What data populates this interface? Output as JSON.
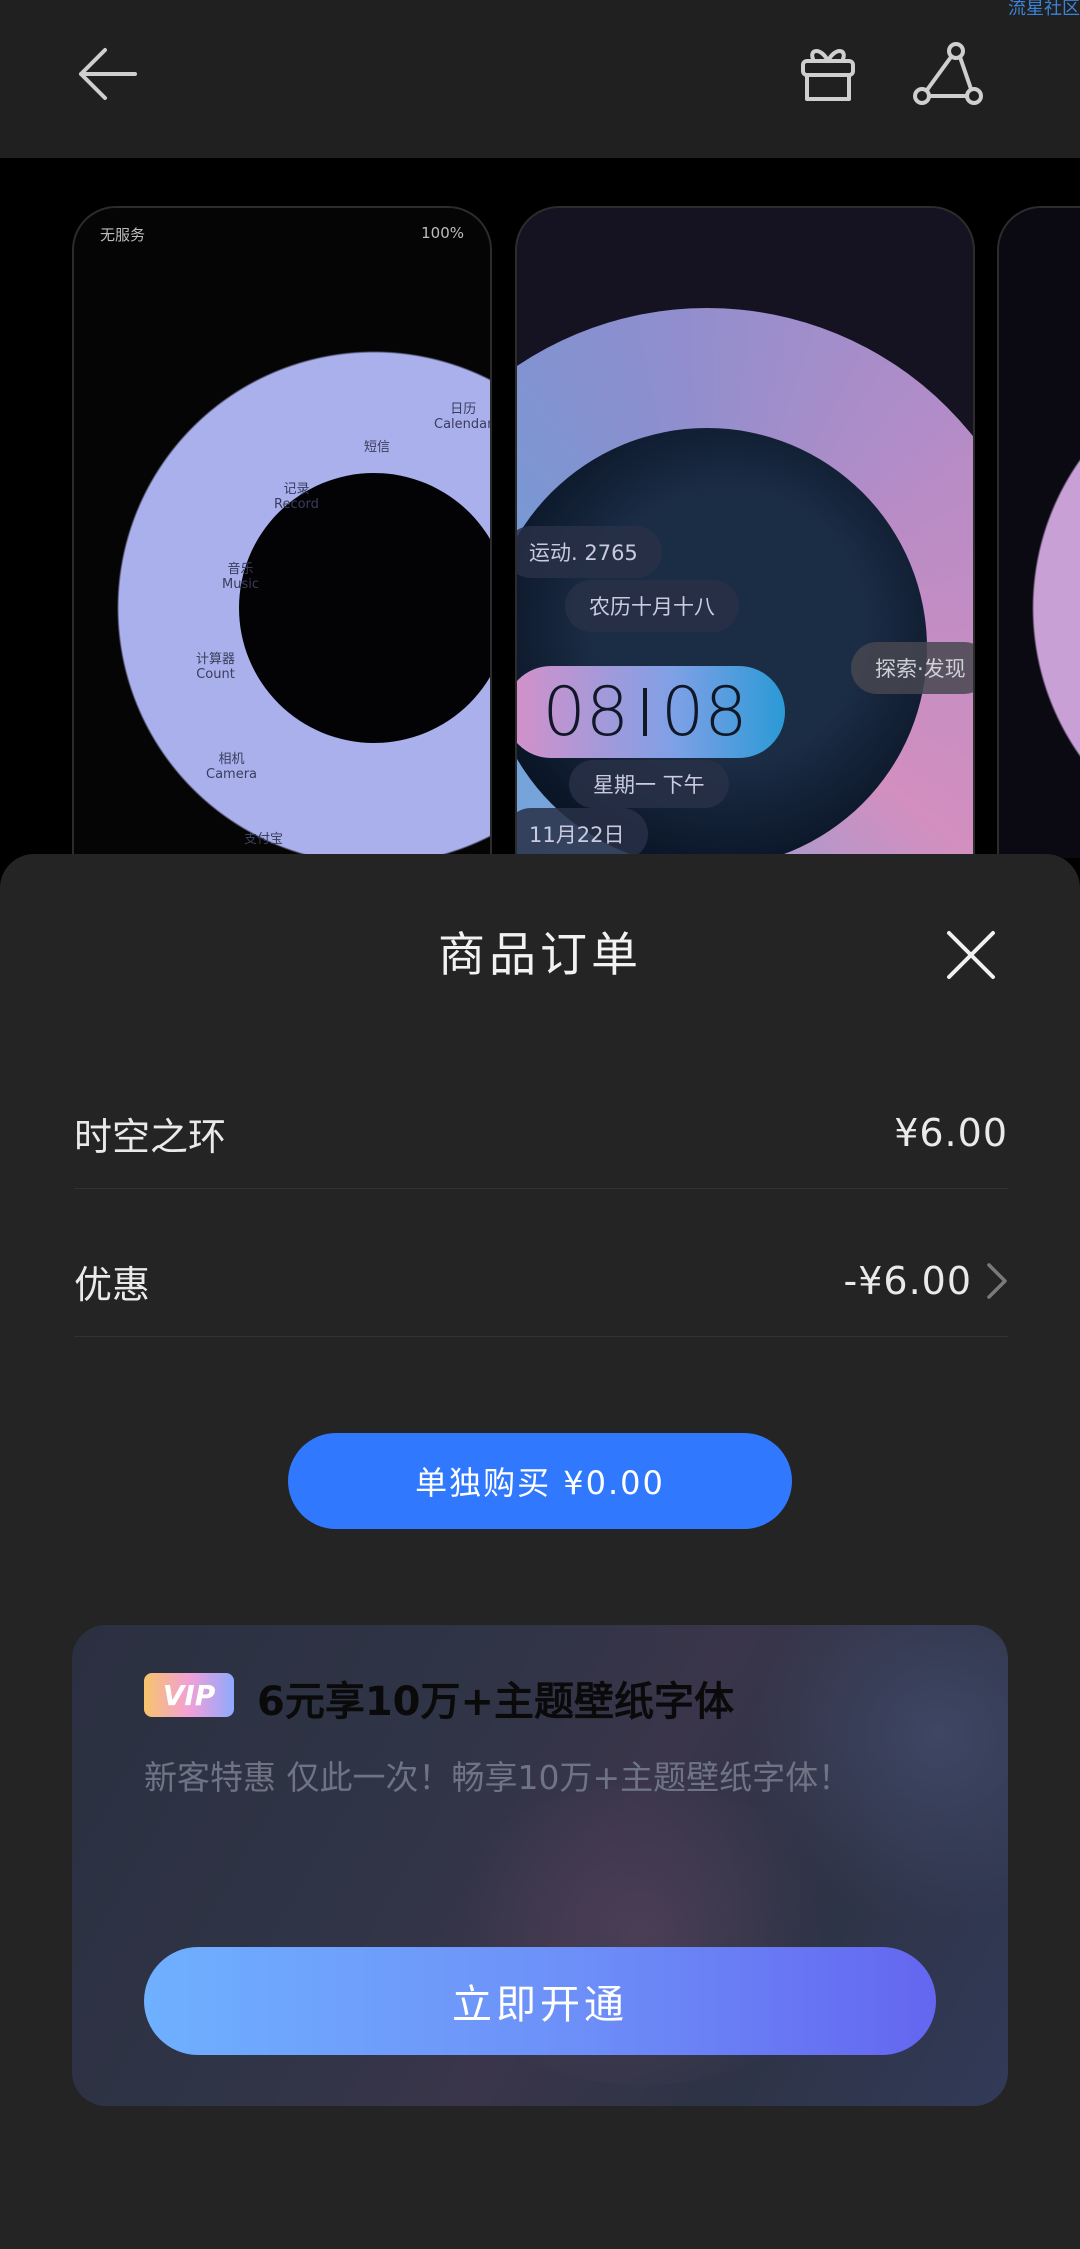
{
  "topbar": {
    "back_icon": "arrow-left-icon",
    "gift_icon": "gift-icon",
    "share_icon": "share-icon",
    "corner_tag": "流星社区"
  },
  "preview": {
    "phone1": {
      "status_left": "无服务",
      "status_right": "100%",
      "apps": [
        {
          "label": "日历",
          "sub": "Calendar"
        },
        {
          "label": "短信",
          "sub": "短信"
        },
        {
          "label": "记录",
          "sub": "Record"
        },
        {
          "label": "音乐",
          "sub": "Music"
        },
        {
          "label": "计算器",
          "sub": "Count"
        },
        {
          "label": "相机",
          "sub": "Camera"
        },
        {
          "label": "支付宝",
          "sub": ""
        }
      ]
    },
    "phone2": {
      "steps": "运动. 2765",
      "lunar": "农历十月十八",
      "hour": "08",
      "minute": "08",
      "weekday": "星期一 下午",
      "date": "11月22日",
      "explore": "探索·发现"
    }
  },
  "order": {
    "title": "商品订单",
    "item_name": "时空之环",
    "item_price": "¥6.00",
    "discount_label": "优惠",
    "discount_value": "-¥6.00",
    "buy_button": "单独购买 ¥0.00"
  },
  "vip": {
    "badge": "VIP",
    "title": "6元享10万+主题壁纸字体",
    "desc": "新客特惠 仅此一次！畅享10万+主题壁纸字体！",
    "cta": "立即开通"
  },
  "colors": {
    "accent": "#3079ff",
    "sheet_bg": "#242424",
    "topbar_bg": "#202020"
  }
}
